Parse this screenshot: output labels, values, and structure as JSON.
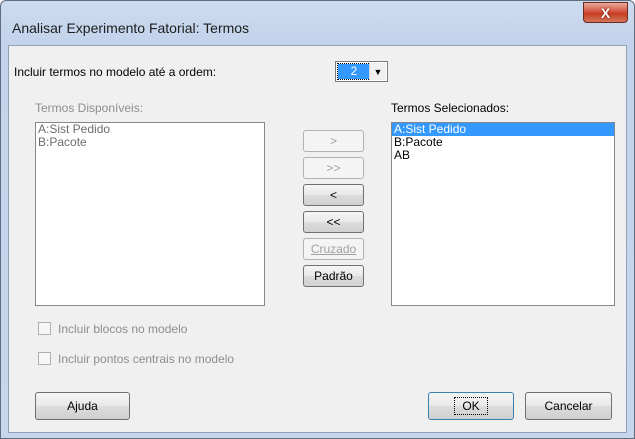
{
  "window": {
    "title": "Analisar Experimento Fatorial: Termos",
    "close_glyph": "X"
  },
  "order": {
    "label": "Incluir termos no modelo até a ordem:",
    "value": "2",
    "arrow": "▼"
  },
  "available": {
    "label": "Termos Disponíveis:",
    "items": [
      "A:Sist Pedido",
      "B:Pacote"
    ]
  },
  "selected": {
    "label": "Termos Selecionados:",
    "items": [
      "A:Sist Pedido",
      "B:Pacote",
      "AB"
    ],
    "selected_index": 0
  },
  "buttons": {
    "add": ">",
    "add_all": ">>",
    "remove": "<",
    "remove_all": "<<",
    "crossed": "Cruzado",
    "default": "Padrão",
    "help": "Ajuda",
    "ok": "OK",
    "cancel": "Cancelar"
  },
  "options": {
    "include_blocks": "Incluir blocos no modelo",
    "include_center_points": "Incluir pontos centrais no modelo"
  }
}
